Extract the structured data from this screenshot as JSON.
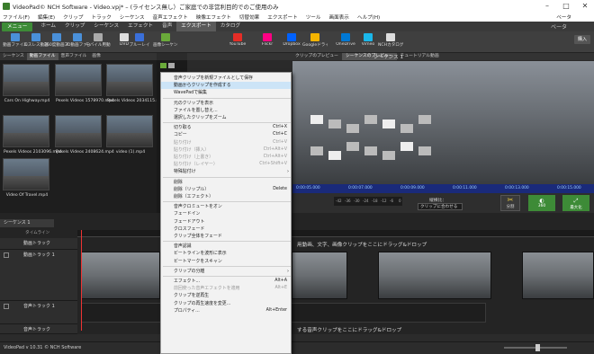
{
  "window": {
    "title": "VideoPad© NCH Software - Video.vpj* – (ライセンス無し）ご家庭での非営利目的でのご使用のみ",
    "controls": [
      "–",
      "□",
      "✕"
    ]
  },
  "menubar": {
    "items": [
      "ファイル(F)",
      "編集(E)",
      "クリップ",
      "トラック",
      "シーケンス",
      "音声エフェクト",
      "映像エフェクト",
      "切替効果",
      "エクスポート",
      "ツール",
      "画面表示",
      "ヘルプ(H)"
    ],
    "beta": "ベータ"
  },
  "ribbon_tabs": {
    "menu_label": "メニュー",
    "tabs": [
      "ホーム",
      "クリップ",
      "シーケンス",
      "エフェクト",
      "音声",
      "エクスポート",
      "カタログ"
    ],
    "active_index": 5,
    "right_label": "ベータ"
  },
  "toolbar": {
    "buttons": [
      {
        "label": "動画ファイル",
        "icon": "film-icon",
        "color": "#4a90d9"
      },
      {
        "label": "ロスレス動画",
        "icon": "film-lossless-icon",
        "color": "#4a90d9"
      },
      {
        "label": "360度動画ファイル",
        "icon": "film-360-icon",
        "color": "#4a90d9"
      },
      {
        "label": "3D動画ファイル",
        "icon": "film-3d-icon",
        "color": "#4a90d9"
      },
      {
        "label": "モバイル用動画",
        "icon": "mobile-icon",
        "color": "#aaaaaa"
      },
      {
        "label": "DVD",
        "icon": "dvd-icon",
        "color": "#dddddd"
      },
      {
        "label": "ブルーレイ",
        "icon": "bluray-icon",
        "color": "#3a6fd9"
      },
      {
        "label": "画像シーケンス",
        "icon": "image-sequence-icon",
        "color": "#6aaa3a"
      },
      {
        "label": "YouTube",
        "icon": "youtube-icon",
        "color": "#e52d27"
      },
      {
        "label": "Flickr",
        "icon": "flickr-icon",
        "color": "#ff0084"
      },
      {
        "label": "Dropbox",
        "icon": "dropbox-icon",
        "color": "#0061fe"
      },
      {
        "label": "Googleドライブ",
        "icon": "google-drive-icon",
        "color": "#f4b400"
      },
      {
        "label": "OneDrive",
        "icon": "onedrive-icon",
        "color": "#0078d4"
      },
      {
        "label": "Vimeo",
        "icon": "vimeo-icon",
        "color": "#1ab7ea"
      },
      {
        "label": "NCHカタログ",
        "icon": "catalog-icon",
        "color": "#dddddd"
      }
    ],
    "purchase_label": "購入"
  },
  "bin": {
    "tabs": [
      "シーケンス",
      "動画ファイル",
      "音声ファイル",
      "画像"
    ],
    "active_tab": 1,
    "clips": [
      {
        "name": "Cars On Highway.mp4"
      },
      {
        "name": "Pexels Videos 1578970.mp4"
      },
      {
        "name": "Pexels Videos 2034115.mp4"
      },
      {
        "name": "Pexels Videos 2103096.mp4"
      },
      {
        "name": "Pexels Videos 2408624.mp4"
      },
      {
        "name": "video (1).mp4"
      },
      {
        "name": "Video Of Travel.mp4"
      }
    ]
  },
  "preview": {
    "tabs": [
      "クリップのプレビュー",
      "シーケンスのプレビュー",
      "チュートリアル動画"
    ],
    "active_tab": 1,
    "sequence_title": "シーケンス 1",
    "ruler_times": [
      "0:00:05.000",
      "0:00:07.000",
      "0:00:09.000",
      "0:00:11.000",
      "0:00:13.000",
      "0:00:15.000"
    ],
    "aspect_label": "縦横比：",
    "aspect_value": "クリップに合わせる",
    "split_label": "分割",
    "view360_label": "360",
    "fullscreen_label": "最大化",
    "meter_ticks": [
      "-42",
      "-36",
      "-30",
      "-24",
      "-18",
      "-12",
      "-6",
      "0"
    ]
  },
  "timeline": {
    "sequence_tab": "シーケンス 1",
    "timeline_label": "タイムライン",
    "overlay_track": "動画トラック",
    "video_track": "動画トラック 1",
    "audio_track": "音声トラック 1",
    "audio_track2": "音声トラック",
    "video_drop_msg": "にドラッグ&ドロップ",
    "overlay_drop_msg": "用動画、文字、画像クリップをここにドラッグ&ドロップ",
    "audio_drop_msg": "する音声クリップをここにドラッグ&ドロップ"
  },
  "status": {
    "text": "VideoPad v 10.31 © NCH Software"
  },
  "context_menu": {
    "items": [
      {
        "label": "音声クリップを新規ファイルとして保存",
        "shortcut": "",
        "disabled": false,
        "submenu": false
      },
      {
        "label": "動画からクリップを作成する",
        "shortcut": "",
        "disabled": false,
        "submenu": false,
        "selected": true
      },
      {
        "label": "WavePadで編集",
        "shortcut": "",
        "disabled": false,
        "submenu": false
      },
      {
        "sep": true
      },
      {
        "label": "元のクリップを表示",
        "shortcut": "",
        "disabled": false,
        "submenu": false
      },
      {
        "label": "ファイルを置し替え...",
        "shortcut": "",
        "disabled": false,
        "submenu": false
      },
      {
        "label": "選択したクリップをズーム",
        "shortcut": "",
        "disabled": false,
        "submenu": false
      },
      {
        "sep": true
      },
      {
        "label": "切り取る",
        "shortcut": "Ctrl+X",
        "disabled": false,
        "submenu": false
      },
      {
        "label": "コピー",
        "shortcut": "Ctrl+C",
        "disabled": false,
        "submenu": false
      },
      {
        "label": "貼り付け",
        "shortcut": "Ctrl+V",
        "disabled": true,
        "submenu": false
      },
      {
        "label": "貼り付け（挿入）",
        "shortcut": "Ctrl+Alt+V",
        "disabled": true,
        "submenu": false
      },
      {
        "label": "貼り付け（上書き）",
        "shortcut": "Ctrl+Alt+V",
        "disabled": true,
        "submenu": false
      },
      {
        "label": "貼り付け（レイヤー）",
        "shortcut": "Ctrl+Shift+V",
        "disabled": true,
        "submenu": false
      },
      {
        "label": "特殊貼付け",
        "shortcut": "",
        "disabled": false,
        "submenu": true
      },
      {
        "sep": true
      },
      {
        "label": "削除",
        "shortcut": "",
        "disabled": false,
        "submenu": false
      },
      {
        "label": "削除（リップル）",
        "shortcut": "Delete",
        "disabled": false,
        "submenu": false
      },
      {
        "label": "削除（エフェクト）",
        "shortcut": "",
        "disabled": false,
        "submenu": false
      },
      {
        "sep": true
      },
      {
        "label": "音声クロミュートをオン",
        "shortcut": "",
        "disabled": false,
        "submenu": false
      },
      {
        "label": "フェードイン",
        "shortcut": "",
        "disabled": false,
        "submenu": false
      },
      {
        "label": "フェードアウト",
        "shortcut": "",
        "disabled": false,
        "submenu": false
      },
      {
        "label": "クロスフェード",
        "shortcut": "",
        "disabled": false,
        "submenu": false
      },
      {
        "label": "クリップ全体をフェード",
        "shortcut": "",
        "disabled": false,
        "submenu": false
      },
      {
        "sep": true
      },
      {
        "label": "音声認識",
        "shortcut": "",
        "disabled": false,
        "submenu": false
      },
      {
        "label": "ビートラインを波形に表示",
        "shortcut": "",
        "disabled": false,
        "submenu": false
      },
      {
        "label": "ビートマークをスキャン",
        "shortcut": "",
        "disabled": false,
        "submenu": false
      },
      {
        "sep": true
      },
      {
        "label": "クリップの分離",
        "shortcut": "",
        "disabled": false,
        "submenu": true
      },
      {
        "sep": true
      },
      {
        "label": "エフェクト...",
        "shortcut": "Alt+A",
        "disabled": false,
        "submenu": false
      },
      {
        "label": "前回使った音声エフェクトを適用",
        "shortcut": "Alt+E",
        "disabled": true,
        "submenu": false
      },
      {
        "label": "クリップを逆再生",
        "shortcut": "",
        "disabled": false,
        "submenu": false
      },
      {
        "label": "クリップの再生速度を変更...",
        "shortcut": "",
        "disabled": false,
        "submenu": false
      },
      {
        "label": "プロパティ...",
        "shortcut": "Alt+Enter",
        "disabled": false,
        "submenu": false
      }
    ]
  }
}
